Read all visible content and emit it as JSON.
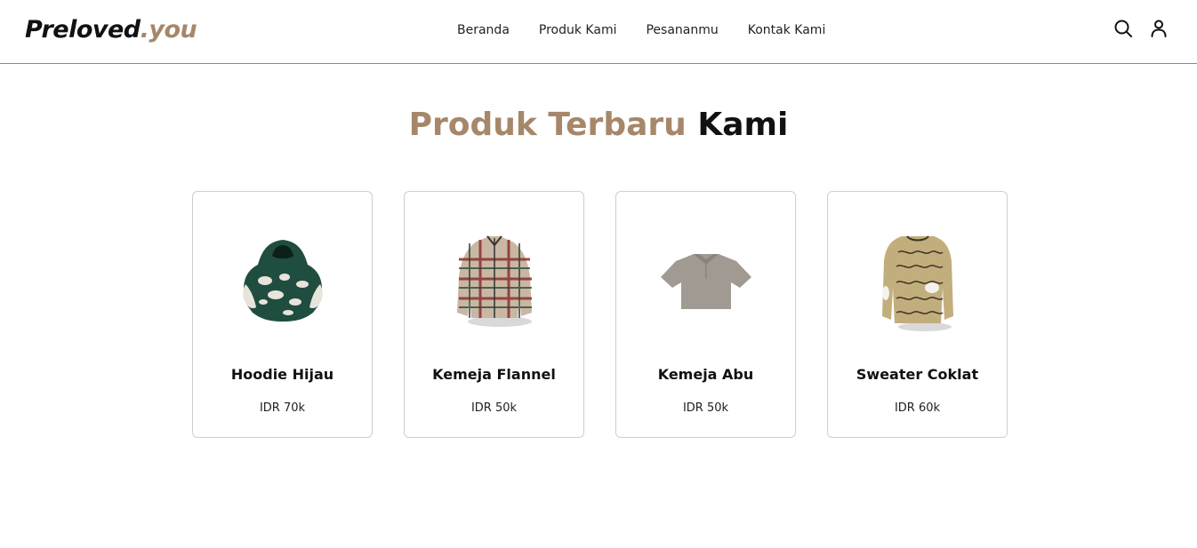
{
  "header": {
    "logo_main": "Preloved",
    "logo_accent": ".you",
    "nav": [
      "Beranda",
      "Produk Kami",
      "Pesananmu",
      "Kontak Kami"
    ],
    "icons": [
      "search-icon",
      "user-icon"
    ]
  },
  "section": {
    "title_accent": "Produk Terbaru",
    "title_main": "Kami"
  },
  "products": [
    {
      "name": "Hoodie Hijau",
      "price": "IDR 70k",
      "image": "hoodie-image"
    },
    {
      "name": "Kemeja Flannel",
      "price": "IDR 50k",
      "image": "flannel-shirt-image"
    },
    {
      "name": "Kemeja Abu",
      "price": "IDR 50k",
      "image": "gray-shirt-image"
    },
    {
      "name": "Sweater Coklat",
      "price": "IDR 60k",
      "image": "sweater-image"
    }
  ],
  "colors": {
    "accent": "#a6876a",
    "text": "#111111",
    "border": "#cfcfcf"
  }
}
